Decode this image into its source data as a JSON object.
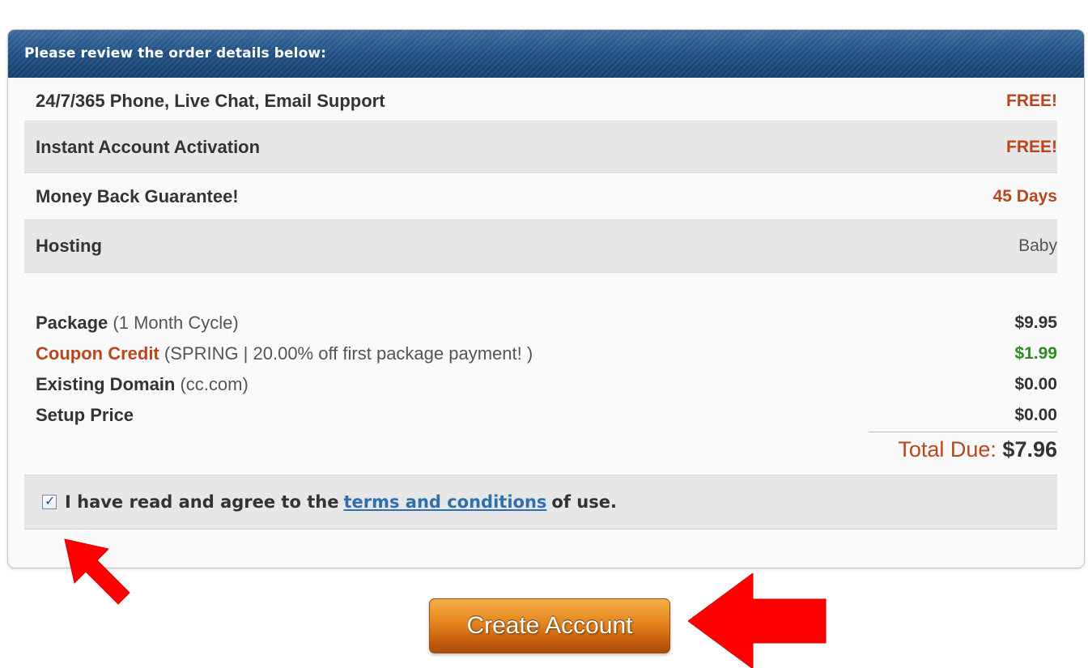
{
  "panel": {
    "header": "Please review the order details below:"
  },
  "features": [
    {
      "label": "24/7/365 Phone, Live Chat, Email Support",
      "value": "FREE!"
    },
    {
      "label": "Instant Account Activation",
      "value": "FREE!"
    },
    {
      "label": "Money Back Guarantee!",
      "value": "45 Days"
    },
    {
      "label": "Hosting",
      "value": "Baby"
    }
  ],
  "line_items": [
    {
      "label": "Package",
      "detail": "(1 Month Cycle)",
      "amount": "$9.95"
    },
    {
      "label": "Coupon Credit",
      "detail": "(SPRING | 20.00% off first package payment! )",
      "amount": "$1.99"
    },
    {
      "label": "Existing Domain",
      "detail": "(cc.com)",
      "amount": "$0.00"
    },
    {
      "label": "Setup Price",
      "detail": "",
      "amount": "$0.00"
    }
  ],
  "total": {
    "label": "Total Due:",
    "amount": "$7.96"
  },
  "agreement": {
    "checked": true,
    "prefix": "I have read and agree to the",
    "link_text": "terms and conditions",
    "suffix": "of use."
  },
  "buttons": {
    "create_account": "Create Account"
  },
  "colors": {
    "header_blue": "#1e4d80",
    "accent_orange": "#b8461e",
    "credit_green": "#2e8b22",
    "annotation_red": "#ff0000",
    "button_orange": "#e68a22"
  },
  "icons": {
    "checkbox": "checkmark",
    "annotation_arrow_1": "red-arrow-pointing-up-left",
    "annotation_arrow_2": "red-arrow-pointing-left"
  }
}
